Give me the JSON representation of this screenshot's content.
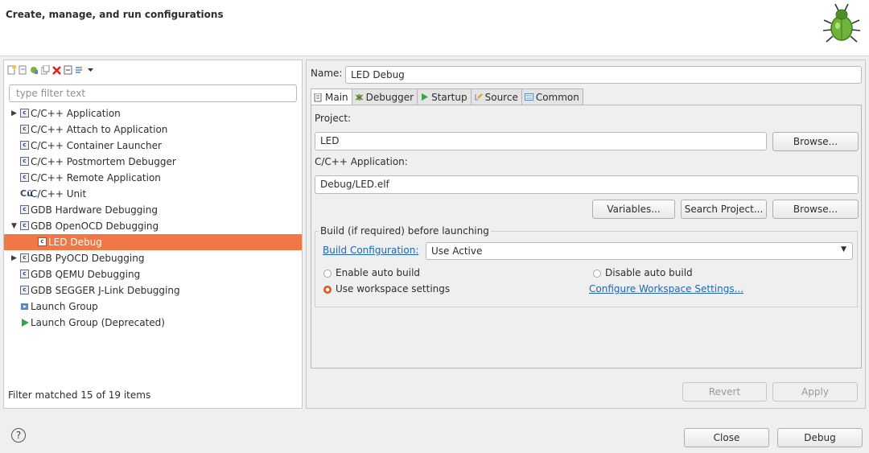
{
  "header": {
    "title": "Create, manage, and run configurations",
    "icon": "bug-icon"
  },
  "left": {
    "filter_placeholder": "type filter text",
    "tree": [
      {
        "label": "C/C++ Application",
        "arrow": "▶",
        "indent": 0,
        "icon": "c-icon"
      },
      {
        "label": "C/C++ Attach to Application",
        "arrow": "",
        "indent": 0,
        "icon": "c-icon"
      },
      {
        "label": "C/C++ Container Launcher",
        "arrow": "",
        "indent": 0,
        "icon": "c-icon"
      },
      {
        "label": "C/C++ Postmortem Debugger",
        "arrow": "",
        "indent": 0,
        "icon": "c-icon"
      },
      {
        "label": "C/C++ Remote Application",
        "arrow": "",
        "indent": 0,
        "icon": "c-icon"
      },
      {
        "label": "C/C++ Unit",
        "arrow": "",
        "indent": 0,
        "icon": "cu-icon"
      },
      {
        "label": "GDB Hardware Debugging",
        "arrow": "",
        "indent": 0,
        "icon": "c-icon"
      },
      {
        "label": "GDB OpenOCD Debugging",
        "arrow": "▼",
        "indent": 0,
        "icon": "c-icon"
      },
      {
        "label": "LED Debug",
        "arrow": "",
        "indent": 1,
        "icon": "c-icon",
        "selected": true
      },
      {
        "label": "GDB PyOCD Debugging",
        "arrow": "▶",
        "indent": 0,
        "icon": "c-icon"
      },
      {
        "label": "GDB QEMU Debugging",
        "arrow": "",
        "indent": 0,
        "icon": "c-icon"
      },
      {
        "label": "GDB SEGGER J-Link Debugging",
        "arrow": "",
        "indent": 0,
        "icon": "c-icon"
      },
      {
        "label": "Launch Group",
        "arrow": "",
        "indent": 0,
        "icon": "launch-group-icon"
      },
      {
        "label": "Launch Group (Deprecated)",
        "arrow": "",
        "indent": 0,
        "icon": "play-icon"
      }
    ],
    "filter_status": "Filter matched 15 of 19 items"
  },
  "right": {
    "name_label": "Name:",
    "name_value": "LED Debug",
    "tabs": [
      {
        "label": "Main",
        "icon": "main-icon",
        "active": true
      },
      {
        "label": "Debugger",
        "icon": "debugger-icon"
      },
      {
        "label": "Startup",
        "icon": "startup-icon"
      },
      {
        "label": "Source",
        "icon": "source-icon"
      },
      {
        "label": "Common",
        "icon": "common-icon"
      }
    ],
    "project_label": "Project:",
    "project_value": "LED",
    "browse_label": "Browse...",
    "app_label": "C/C++ Application:",
    "app_value": "Debug/LED.elf",
    "variables_label": "Variables...",
    "search_project_label": "Search Project...",
    "build_group_title": "Build (if required) before launching",
    "build_config_label": "Build Configuration:",
    "build_config_value": "Use Active",
    "enable_auto_build": "Enable auto build",
    "disable_auto_build": "Disable auto build",
    "use_workspace_settings": "Use workspace settings",
    "configure_workspace": "Configure Workspace Settings...",
    "selected_option": "use_workspace_settings",
    "revert_label": "Revert",
    "apply_label": "Apply"
  },
  "footer": {
    "close_label": "Close",
    "debug_label": "Debug",
    "help": "?"
  }
}
